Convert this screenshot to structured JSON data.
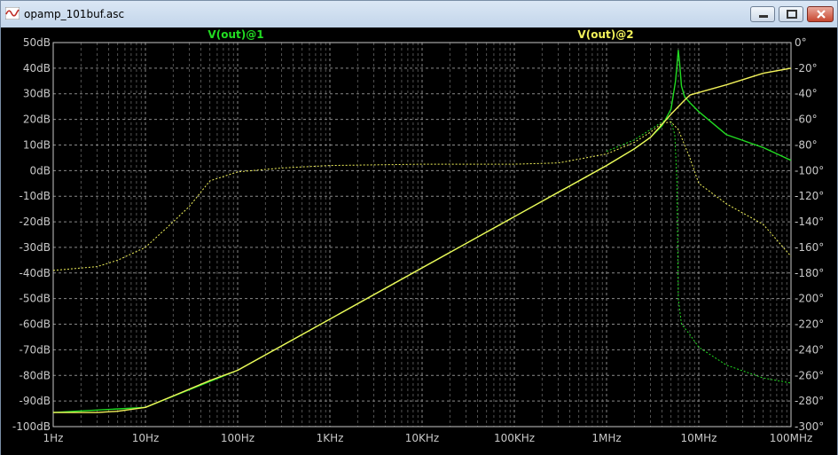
{
  "window": {
    "title": "opamp_101buf.asc"
  },
  "colors": {
    "trace1": "#22dd22",
    "trace2": "#f2f25a",
    "grid": "#8a8a8a",
    "axis_text": "#c8c8c8",
    "background": "#000000"
  },
  "chart_data": {
    "type": "line",
    "xscale": "log",
    "xlim": [
      1,
      100000000
    ],
    "ylim": [
      -100,
      50
    ],
    "y2lim": [
      -300,
      0
    ],
    "grid": true,
    "x_ticks": [
      {
        "value": 1,
        "label": "1Hz"
      },
      {
        "value": 10,
        "label": "10Hz"
      },
      {
        "value": 100,
        "label": "100Hz"
      },
      {
        "value": 1000,
        "label": "1KHz"
      },
      {
        "value": 10000,
        "label": "10KHz"
      },
      {
        "value": 100000,
        "label": "100KHz"
      },
      {
        "value": 1000000,
        "label": "1MHz"
      },
      {
        "value": 10000000,
        "label": "10MHz"
      },
      {
        "value": 100000000,
        "label": "100MHz"
      }
    ],
    "y_ticks": [
      {
        "value": 50,
        "label": "50dB"
      },
      {
        "value": 40,
        "label": "40dB"
      },
      {
        "value": 30,
        "label": "30dB"
      },
      {
        "value": 20,
        "label": "20dB"
      },
      {
        "value": 10,
        "label": "10dB"
      },
      {
        "value": 0,
        "label": "0dB"
      },
      {
        "value": -10,
        "label": "-10dB"
      },
      {
        "value": -20,
        "label": "-20dB"
      },
      {
        "value": -30,
        "label": "-30dB"
      },
      {
        "value": -40,
        "label": "-40dB"
      },
      {
        "value": -50,
        "label": "-50dB"
      },
      {
        "value": -60,
        "label": "-60dB"
      },
      {
        "value": -70,
        "label": "-70dB"
      },
      {
        "value": -80,
        "label": "-80dB"
      },
      {
        "value": -90,
        "label": "-90dB"
      },
      {
        "value": -100,
        "label": "-100dB"
      }
    ],
    "y2_ticks": [
      {
        "value": 0,
        "label": "0°"
      },
      {
        "value": -20,
        "label": "-20°"
      },
      {
        "value": -40,
        "label": "-40°"
      },
      {
        "value": -60,
        "label": "-60°"
      },
      {
        "value": -80,
        "label": "-80°"
      },
      {
        "value": -100,
        "label": "-100°"
      },
      {
        "value": -120,
        "label": "-120°"
      },
      {
        "value": -140,
        "label": "-140°"
      },
      {
        "value": -160,
        "label": "-160°"
      },
      {
        "value": -180,
        "label": "-180°"
      },
      {
        "value": -200,
        "label": "-200°"
      },
      {
        "value": -220,
        "label": "-220°"
      },
      {
        "value": -240,
        "label": "-240°"
      },
      {
        "value": -260,
        "label": "-260°"
      },
      {
        "value": -280,
        "label": "-280°"
      },
      {
        "value": -300,
        "label": "-300°"
      }
    ],
    "series": [
      {
        "name": "V(out)@1",
        "color": "#22dd22",
        "magnitude": {
          "x": [
            1,
            10,
            100,
            1000,
            10000,
            100000,
            1000000,
            2000000,
            3000000,
            4000000,
            5000000,
            5600000,
            6000000,
            6200000,
            6500000,
            7000000,
            8000000,
            10000000,
            20000000,
            50000000,
            100000000
          ],
          "y": [
            -94.5,
            -92.5,
            -78,
            -58,
            -38,
            -18,
            2,
            8.5,
            13,
            17.5,
            24,
            35,
            47,
            42,
            33,
            29,
            26.5,
            23,
            14,
            9,
            4
          ]
        },
        "phase": {
          "x": [
            1000000,
            2000000,
            3000000,
            4000000,
            4700000,
            5000000,
            5500000,
            5800000,
            6000000,
            6500000,
            8000000,
            10000000,
            20000000,
            50000000,
            100000000
          ],
          "y": [
            -85,
            -76,
            -68,
            -62,
            -59,
            -62,
            -72,
            -110,
            -200,
            -220,
            -228,
            -238,
            -252,
            -262,
            -266
          ]
        }
      },
      {
        "name": "V(out)@2",
        "color": "#f2f25a",
        "magnitude": {
          "x": [
            1,
            3,
            5,
            10,
            20,
            50,
            100,
            1000,
            10000,
            100000,
            1000000,
            2000000,
            3000000,
            5000000,
            7000000,
            8000000,
            10000000,
            20000000,
            50000000,
            100000000
          ],
          "y": [
            -94.5,
            -94.5,
            -94,
            -92.5,
            -88,
            -82,
            -78,
            -58,
            -38,
            -18,
            2,
            8.5,
            13,
            22,
            27.5,
            29.5,
            30.5,
            33.5,
            38,
            40
          ]
        },
        "phase": {
          "x": [
            1,
            3,
            5,
            10,
            20,
            30,
            50,
            100,
            300,
            1000,
            10000,
            100000,
            300000,
            1000000,
            2000000,
            3000000,
            4000000,
            5000000,
            6000000,
            8000000,
            10000000,
            20000000,
            50000000,
            100000000
          ],
          "y": [
            -178,
            -175,
            -170,
            -160,
            -140,
            -128,
            -108,
            -101,
            -98,
            -96,
            -95,
            -95,
            -94,
            -87,
            -78,
            -70,
            -63,
            -62,
            -68,
            -90,
            -110,
            -126,
            -142,
            -167
          ]
        }
      }
    ]
  }
}
